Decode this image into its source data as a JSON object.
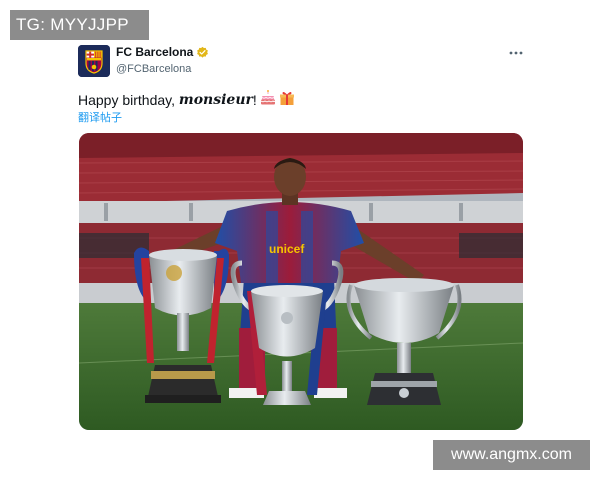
{
  "watermarks": {
    "top": "TG: MYYJJPP",
    "bottom": "www.angmx.com"
  },
  "tweet": {
    "display_name": "FC Barcelona",
    "handle": "@FCBarcelona",
    "verified_icon": "gold-verified-badge-icon",
    "more_icon": "more-options-icon",
    "text_before": "Happy birthday, ",
    "text_emphasis": "monsieur",
    "text_after": "!",
    "emojis": [
      "birthday-cake-icon",
      "gift-icon"
    ],
    "translate_label": "翻译帖子",
    "colors": {
      "accent": "#1d9bf0",
      "muted": "#536471",
      "verified_gold": "#e2b719"
    }
  },
  "photo": {
    "jersey_sponsor": "unicef"
  }
}
